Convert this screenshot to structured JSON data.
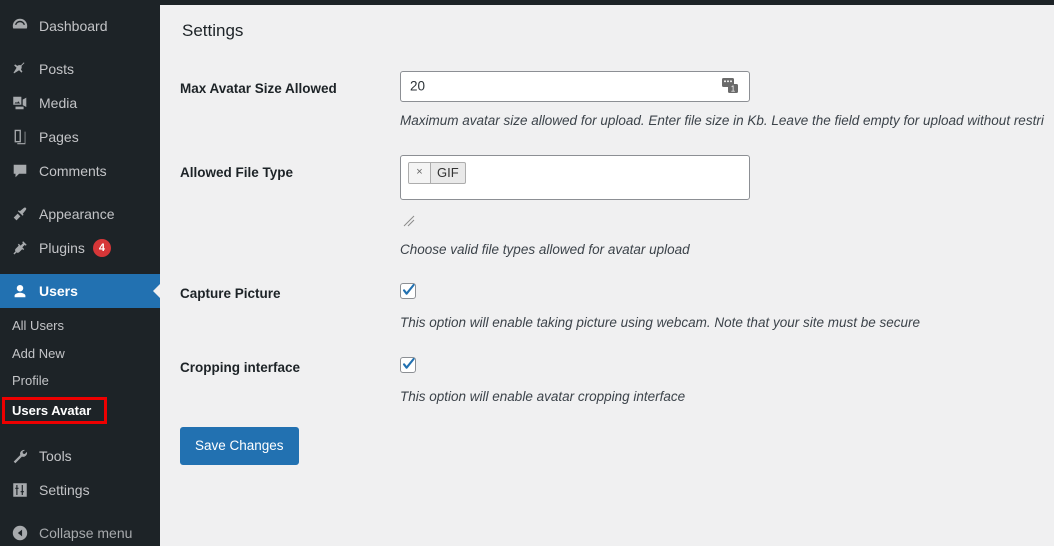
{
  "colors": {
    "sidebar_bg": "#1d2327",
    "accent": "#2271b1",
    "content_bg": "#f0f0f1",
    "badge_bg": "#d63638",
    "highlight_box": "#ee0000"
  },
  "sidebar": {
    "items": [
      {
        "label": "Dashboard",
        "icon": "dashboard-gauge-icon",
        "active": false,
        "badge": null
      },
      {
        "label": "Posts",
        "icon": "pin-icon",
        "active": false,
        "badge": null
      },
      {
        "label": "Media",
        "icon": "media-icon",
        "active": false,
        "badge": null
      },
      {
        "label": "Pages",
        "icon": "pages-icon",
        "active": false,
        "badge": null
      },
      {
        "label": "Comments",
        "icon": "comment-bubble-icon",
        "active": false,
        "badge": null
      },
      {
        "label": "Appearance",
        "icon": "paintbrush-icon",
        "active": false,
        "badge": null
      },
      {
        "label": "Plugins",
        "icon": "plug-icon",
        "active": false,
        "badge": "4"
      },
      {
        "label": "Users",
        "icon": "user-icon",
        "active": true,
        "badge": null
      },
      {
        "label": "Tools",
        "icon": "wrench-icon",
        "active": false,
        "badge": null
      },
      {
        "label": "Settings",
        "icon": "sliders-icon",
        "active": false,
        "badge": null
      },
      {
        "label": "Collapse menu",
        "icon": "collapse-arrow-icon",
        "active": false,
        "badge": null
      }
    ],
    "submenu": [
      {
        "label": "All Users",
        "current": false
      },
      {
        "label": "Add New",
        "current": false
      },
      {
        "label": "Profile",
        "current": false
      },
      {
        "label": "Users Avatar",
        "current": true,
        "highlighted": true
      }
    ]
  },
  "main": {
    "page_title": "Settings",
    "rows": {
      "max_avatar_size": {
        "label": "Max Avatar Size Allowed",
        "value": "20",
        "placeholder": "",
        "spinner_icon": "number-spinner-icon",
        "description": "Maximum avatar size allowed for upload. Enter file size in Kb. Leave the field empty for upload without restri"
      },
      "allowed_file_type": {
        "label": "Allowed File Type",
        "tags": [
          {
            "remove_label": "×",
            "label": "GIF"
          }
        ],
        "resize_grip": "resize-grip-icon",
        "description": "Choose valid file types allowed for avatar upload"
      },
      "capture_picture": {
        "label": "Capture Picture",
        "checked": true,
        "description": "This option will enable taking picture using webcam. Note that your site must be secure"
      },
      "cropping_interface": {
        "label": "Cropping interface",
        "checked": true,
        "description": "This option will enable avatar cropping interface"
      }
    },
    "save_button": "Save Changes"
  }
}
